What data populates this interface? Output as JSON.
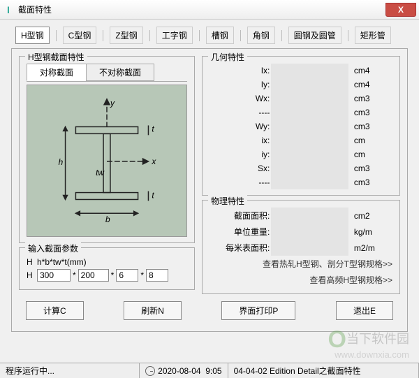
{
  "window": {
    "title": "截面特性",
    "close_x": "X"
  },
  "tabs": [
    "H型钢",
    "C型钢",
    "Z型钢",
    "工字钢",
    "槽钢",
    "角钢",
    "圆钢及圆管",
    "矩形管"
  ],
  "left_group": {
    "legend": "H型钢截面特性",
    "subtabs": [
      "对称截面",
      "不对称截面"
    ],
    "diagram": {
      "y": "y",
      "x": "x",
      "t": "t",
      "tw": "tw",
      "b": "b",
      "h": "h"
    },
    "params_legend": "输入截面参数",
    "format_label": "H",
    "format_text": "h*b*tw*t(mm)",
    "input_label": "H",
    "H": "300",
    "B": "200",
    "tw": "6",
    "t": "8",
    "star": "*"
  },
  "geo": {
    "legend": "几何特性",
    "rows": [
      {
        "k": "Ix:",
        "u": "cm4"
      },
      {
        "k": "Iy:",
        "u": "cm4"
      },
      {
        "k": "Wx:",
        "u": "cm3"
      },
      {
        "k": "----",
        "u": "cm3"
      },
      {
        "k": "Wy:",
        "u": "cm3"
      },
      {
        "k": "ix:",
        "u": "cm"
      },
      {
        "k": "iy:",
        "u": "cm"
      },
      {
        "k": "Sx:",
        "u": "cm3"
      },
      {
        "k": "----",
        "u": "cm3"
      }
    ]
  },
  "phys": {
    "legend": "物理特性",
    "rows": [
      {
        "k": "截面面积:",
        "u": "cm2"
      },
      {
        "k": "单位重量:",
        "u": "kg/m"
      },
      {
        "k": "每米表面积:",
        "u": "m2/m"
      }
    ],
    "link1": "查看热轧H型钢、剖分T型钢规格>>",
    "link2": "查看高频H型钢规格>>"
  },
  "buttons": {
    "calc": "计算C",
    "refresh": "刷新N",
    "print": "界面打印P",
    "exit": "退出E"
  },
  "status": {
    "run": "程序运行中...",
    "date": "2020-08-04",
    "time": "9:05",
    "ver": "04-04-02 Edition  Detail之截面特性"
  },
  "watermark": {
    "cn": "当下软件园",
    "url": "www.downxia.com"
  }
}
